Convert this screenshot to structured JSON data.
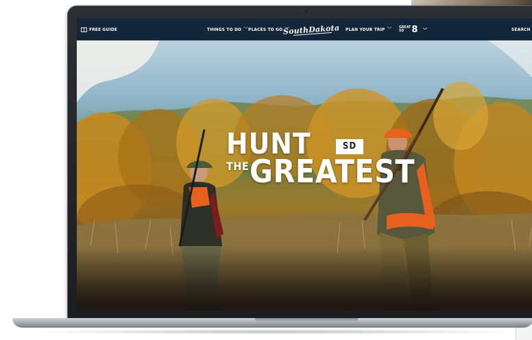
{
  "nav": {
    "free_guide": "FREE GUIDE",
    "things_to_do": "THINGS TO DO",
    "places_to_go": "PLACES TO GO",
    "logo_text": "SouthDakota",
    "plan_your_trip": "PLAN YOUR TRIP",
    "great8_small_top": "GREAT",
    "great8_small_bottom": "SD",
    "great8_number": "8",
    "search": "SEARCH"
  },
  "hero": {
    "line1": "HUNT",
    "badge": "SD",
    "line2": "THE",
    "line3": "GREATEST"
  },
  "colors": {
    "nav_background": "#14263a",
    "headline": "#ffffff",
    "hunter_orange": "#e7611e"
  },
  "icons": {
    "free_guide": "book-icon",
    "dropdown": "chevron-down-icon",
    "search": "search-icon"
  }
}
